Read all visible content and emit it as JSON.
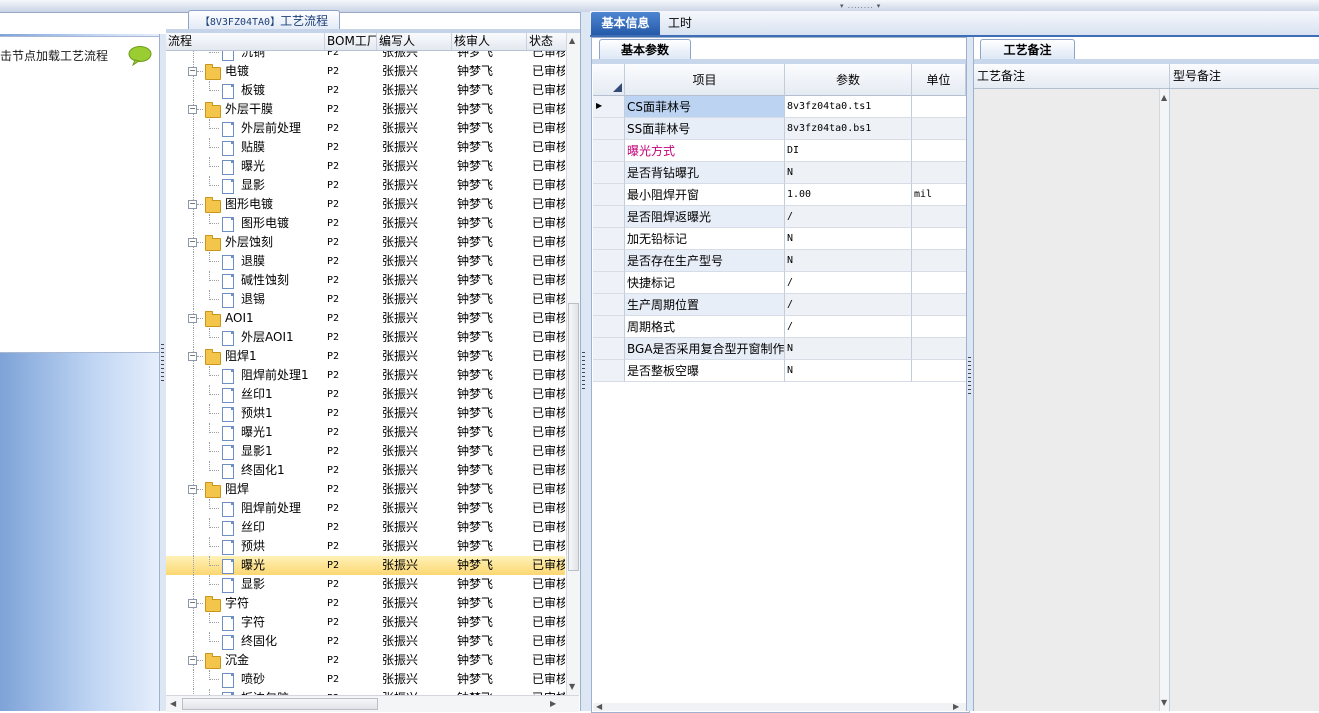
{
  "left_panel": {
    "hint": "击节点加载工艺流程",
    "chat_icon": "speech-bubble-icon"
  },
  "process_tab": {
    "code": "【8V3FZ04TA0】",
    "label": "工艺流程"
  },
  "tree": {
    "columns": [
      "流程",
      "BOM工厂",
      "编写人",
      "核审人",
      "状态"
    ],
    "rows": [
      {
        "label": "沉铜",
        "type": "doc",
        "level": 1,
        "bom": "P2",
        "writer": "张振兴",
        "reviewer": "钟梦飞",
        "status": "已审核"
      },
      {
        "label": "电镀",
        "type": "folder",
        "level": 0,
        "bom": "P2",
        "writer": "张振兴",
        "reviewer": "钟梦飞",
        "status": "已审核"
      },
      {
        "label": "板镀",
        "type": "doc",
        "level": 1,
        "bom": "P2",
        "writer": "张振兴",
        "reviewer": "钟梦飞",
        "status": "已审核"
      },
      {
        "label": "外层干膜",
        "type": "folder",
        "level": 0,
        "bom": "P2",
        "writer": "张振兴",
        "reviewer": "钟梦飞",
        "status": "已审核"
      },
      {
        "label": "外层前处理",
        "type": "doc",
        "level": 1,
        "bom": "P2",
        "writer": "张振兴",
        "reviewer": "钟梦飞",
        "status": "已审核"
      },
      {
        "label": "贴膜",
        "type": "doc",
        "level": 1,
        "bom": "P2",
        "writer": "张振兴",
        "reviewer": "钟梦飞",
        "status": "已审核"
      },
      {
        "label": "曝光",
        "type": "doc",
        "level": 1,
        "bom": "P2",
        "writer": "张振兴",
        "reviewer": "钟梦飞",
        "status": "已审核"
      },
      {
        "label": "显影",
        "type": "doc",
        "level": 1,
        "bom": "P2",
        "writer": "张振兴",
        "reviewer": "钟梦飞",
        "status": "已审核"
      },
      {
        "label": "图形电镀",
        "type": "folder",
        "level": 0,
        "bom": "P2",
        "writer": "张振兴",
        "reviewer": "钟梦飞",
        "status": "已审核"
      },
      {
        "label": "图形电镀",
        "type": "doc",
        "level": 1,
        "bom": "P2",
        "writer": "张振兴",
        "reviewer": "钟梦飞",
        "status": "已审核"
      },
      {
        "label": "外层蚀刻",
        "type": "folder",
        "level": 0,
        "bom": "P2",
        "writer": "张振兴",
        "reviewer": "钟梦飞",
        "status": "已审核"
      },
      {
        "label": "退膜",
        "type": "doc",
        "level": 1,
        "bom": "P2",
        "writer": "张振兴",
        "reviewer": "钟梦飞",
        "status": "已审核"
      },
      {
        "label": "碱性蚀刻",
        "type": "doc",
        "level": 1,
        "bom": "P2",
        "writer": "张振兴",
        "reviewer": "钟梦飞",
        "status": "已审核"
      },
      {
        "label": "退锡",
        "type": "doc",
        "level": 1,
        "bom": "P2",
        "writer": "张振兴",
        "reviewer": "钟梦飞",
        "status": "已审核"
      },
      {
        "label": "AOI1",
        "type": "folder",
        "level": 0,
        "bom": "P2",
        "writer": "张振兴",
        "reviewer": "钟梦飞",
        "status": "已审核"
      },
      {
        "label": "外层AOI1",
        "type": "doc",
        "level": 1,
        "bom": "P2",
        "writer": "张振兴",
        "reviewer": "钟梦飞",
        "status": "已审核"
      },
      {
        "label": "阻焊1",
        "type": "folder",
        "level": 0,
        "bom": "P2",
        "writer": "张振兴",
        "reviewer": "钟梦飞",
        "status": "已审核"
      },
      {
        "label": "阻焊前处理1",
        "type": "doc",
        "level": 1,
        "bom": "P2",
        "writer": "张振兴",
        "reviewer": "钟梦飞",
        "status": "已审核"
      },
      {
        "label": "丝印1",
        "type": "doc",
        "level": 1,
        "bom": "P2",
        "writer": "张振兴",
        "reviewer": "钟梦飞",
        "status": "已审核"
      },
      {
        "label": "预烘1",
        "type": "doc",
        "level": 1,
        "bom": "P2",
        "writer": "张振兴",
        "reviewer": "钟梦飞",
        "status": "已审核"
      },
      {
        "label": "曝光1",
        "type": "doc",
        "level": 1,
        "bom": "P2",
        "writer": "张振兴",
        "reviewer": "钟梦飞",
        "status": "已审核"
      },
      {
        "label": "显影1",
        "type": "doc",
        "level": 1,
        "bom": "P2",
        "writer": "张振兴",
        "reviewer": "钟梦飞",
        "status": "已审核"
      },
      {
        "label": "终固化1",
        "type": "doc",
        "level": 1,
        "bom": "P2",
        "writer": "张振兴",
        "reviewer": "钟梦飞",
        "status": "已审核"
      },
      {
        "label": "阻焊",
        "type": "folder",
        "level": 0,
        "bom": "P2",
        "writer": "张振兴",
        "reviewer": "钟梦飞",
        "status": "已审核"
      },
      {
        "label": "阻焊前处理",
        "type": "doc",
        "level": 1,
        "bom": "P2",
        "writer": "张振兴",
        "reviewer": "钟梦飞",
        "status": "已审核"
      },
      {
        "label": "丝印",
        "type": "doc",
        "level": 1,
        "bom": "P2",
        "writer": "张振兴",
        "reviewer": "钟梦飞",
        "status": "已审核"
      },
      {
        "label": "预烘",
        "type": "doc",
        "level": 1,
        "bom": "P2",
        "writer": "张振兴",
        "reviewer": "钟梦飞",
        "status": "已审核"
      },
      {
        "label": "曝光",
        "type": "doc",
        "level": 1,
        "bom": "P2",
        "writer": "张振兴",
        "reviewer": "钟梦飞",
        "status": "已审核",
        "selected": true
      },
      {
        "label": "显影",
        "type": "doc",
        "level": 1,
        "bom": "P2",
        "writer": "张振兴",
        "reviewer": "钟梦飞",
        "status": "已审核"
      },
      {
        "label": "字符",
        "type": "folder",
        "level": 0,
        "bom": "P2",
        "writer": "张振兴",
        "reviewer": "钟梦飞",
        "status": "已审核"
      },
      {
        "label": "字符",
        "type": "doc",
        "level": 1,
        "bom": "P2",
        "writer": "张振兴",
        "reviewer": "钟梦飞",
        "status": "已审核"
      },
      {
        "label": "终固化",
        "type": "doc",
        "level": 1,
        "bom": "P2",
        "writer": "张振兴",
        "reviewer": "钟梦飞",
        "status": "已审核"
      },
      {
        "label": "沉金",
        "type": "folder",
        "level": 0,
        "bom": "P2",
        "writer": "张振兴",
        "reviewer": "钟梦飞",
        "status": "已审核"
      },
      {
        "label": "喷砂",
        "type": "doc",
        "level": 1,
        "bom": "P2",
        "writer": "张振兴",
        "reviewer": "钟梦飞",
        "status": "已审核"
      },
      {
        "label": "板边包胶",
        "type": "doc",
        "level": 1,
        "bom": "P2",
        "writer": "张振兴",
        "reviewer": "钟梦飞",
        "status": "已审核"
      }
    ]
  },
  "right_tabs": [
    {
      "label": "基本信息",
      "active": true
    },
    {
      "label": "工时",
      "active": false
    }
  ],
  "basic_params": {
    "tab_label": "基本参数",
    "headers": {
      "item": "项目",
      "param": "参数",
      "unit": "单位"
    },
    "rows": [
      {
        "item": "CS面菲林号",
        "param": "8v3fz04ta0.ts1",
        "unit": "",
        "current": true
      },
      {
        "item": "SS面菲林号",
        "param": "8v3fz04ta0.bs1",
        "unit": ""
      },
      {
        "item": "曝光方式",
        "param": "DI",
        "unit": "",
        "highlight_color": "#c0007a"
      },
      {
        "item": "是否背钻曝孔",
        "param": "N",
        "unit": ""
      },
      {
        "item": "最小阻焊开窗",
        "param": "1.00",
        "unit": "mil"
      },
      {
        "item": "是否阻焊返曝光",
        "param": "/",
        "unit": ""
      },
      {
        "item": "加无铅标记",
        "param": "N",
        "unit": ""
      },
      {
        "item": "是否存在生产型号",
        "param": "N",
        "unit": ""
      },
      {
        "item": "快捷标记",
        "param": "/",
        "unit": ""
      },
      {
        "item": "生产周期位置",
        "param": "/",
        "unit": ""
      },
      {
        "item": "周期格式",
        "param": "/",
        "unit": ""
      },
      {
        "item": "BGA是否采用复合型开窗制作",
        "param": "N",
        "unit": ""
      },
      {
        "item": "是否整板空曝",
        "param": "N",
        "unit": ""
      }
    ]
  },
  "notes": {
    "tab_label": "工艺备注",
    "col1": "工艺备注",
    "col2": "型号备注"
  },
  "colors": {
    "selection": "#fbd772",
    "accent": "#245aa8"
  }
}
